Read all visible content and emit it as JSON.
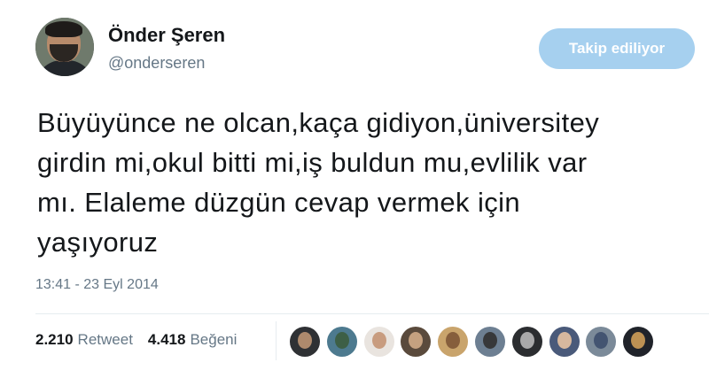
{
  "user": {
    "display_name": "Önder Şeren",
    "username": "@onderseren",
    "follow_button": "Takip ediliyor"
  },
  "tweet": {
    "lines": [
      "Büyüyünce ne olcan,kaça gidiyon,üniversitey",
      "girdin mi,okul bitti mi,iş buldun mu,evlilik var",
      "mı. Elaleme düzgün cevap vermek için",
      "yaşıyoruz"
    ],
    "timestamp": "13:41 - 23 Eyl 2014"
  },
  "stats": {
    "retweets_count": "2.210",
    "retweets_label": "Retweet",
    "likes_count": "4.418",
    "likes_label": "Beğeni"
  },
  "likers": [
    {
      "icon": "user-avatar-icon",
      "bg": "#2f3134",
      "face": "#c49a78"
    },
    {
      "icon": "user-avatar-icon",
      "bg": "#4d7a8f",
      "face": "#3b5b3a"
    },
    {
      "icon": "user-avatar-icon",
      "bg": "#e9e4df",
      "face": "#c28f6f"
    },
    {
      "icon": "user-avatar-icon",
      "bg": "#5a4a3c",
      "face": "#d8b08c"
    },
    {
      "icon": "user-avatar-icon",
      "bg": "#c9a46c",
      "face": "#7a5234"
    },
    {
      "icon": "user-avatar-icon",
      "bg": "#6d7f92",
      "face": "#2e2b2a"
    },
    {
      "icon": "user-avatar-icon",
      "bg": "#2b2d30",
      "face": "#bfbfbf"
    },
    {
      "icon": "user-avatar-icon",
      "bg": "#4a5a7a",
      "face": "#f0c9a4"
    },
    {
      "icon": "user-avatar-icon",
      "bg": "#7b8a99",
      "face": "#3a4a6a"
    },
    {
      "icon": "user-avatar-icon",
      "bg": "#20232a",
      "face": "#d9a45a"
    }
  ]
}
